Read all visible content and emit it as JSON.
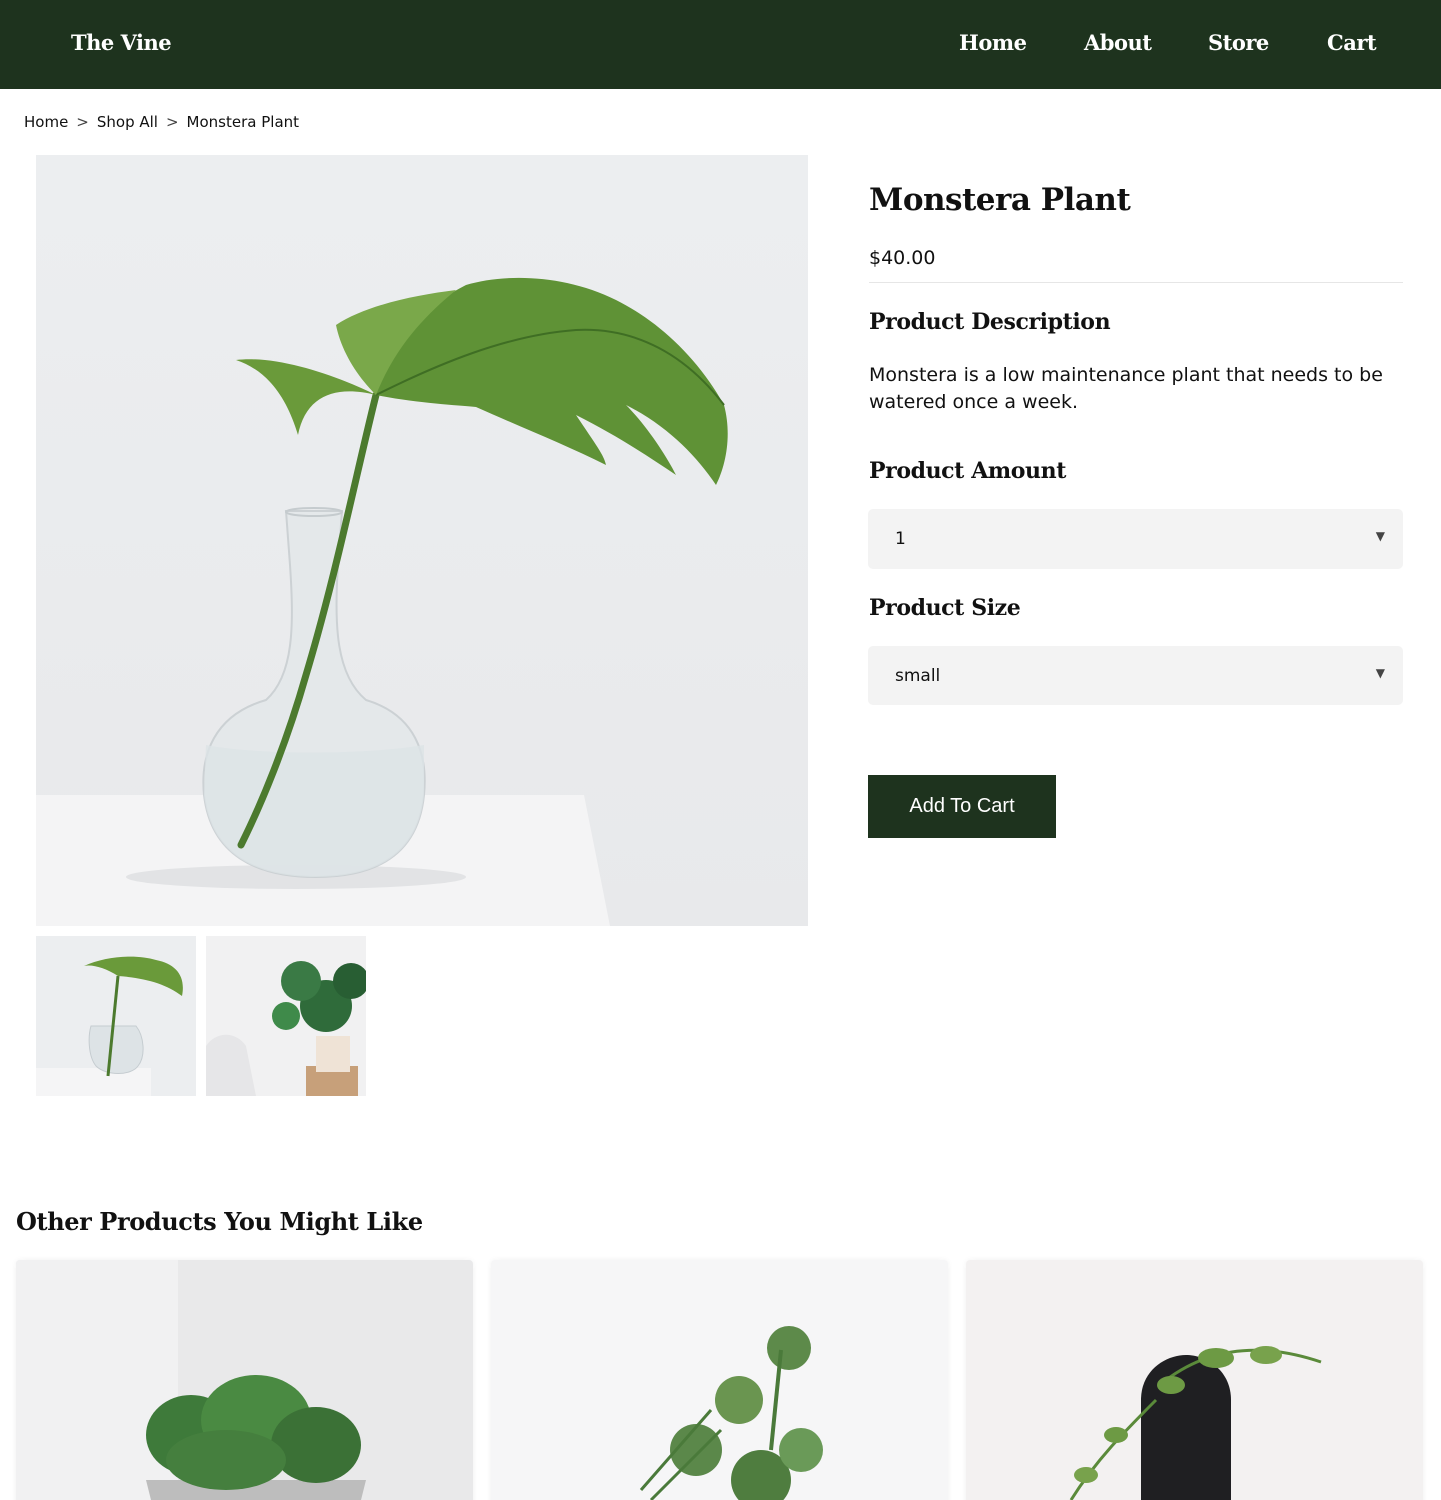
{
  "nav": {
    "brand": "The Vine",
    "links": [
      "Home",
      "About",
      "Store",
      "Cart"
    ]
  },
  "breadcrumb": {
    "items": [
      "Home",
      "Shop All",
      "Monstera Plant"
    ],
    "separator": ">"
  },
  "product": {
    "title": "Monstera Plant",
    "price": "$40.00",
    "description_heading": "Product Description",
    "description": "Monstera is a low maintenance plant that needs to be watered once a week.",
    "amount_heading": "Product Amount",
    "amount_value": "1",
    "size_heading": "Product Size",
    "size_value": "small",
    "add_to_cart": "Add To Cart"
  },
  "related": {
    "heading": "Other Products You Might Like"
  },
  "icons": {
    "select_caret": "caret-down-icon"
  },
  "colors": {
    "brand_green": "#1e331e",
    "select_bg": "#f3f3f3"
  }
}
